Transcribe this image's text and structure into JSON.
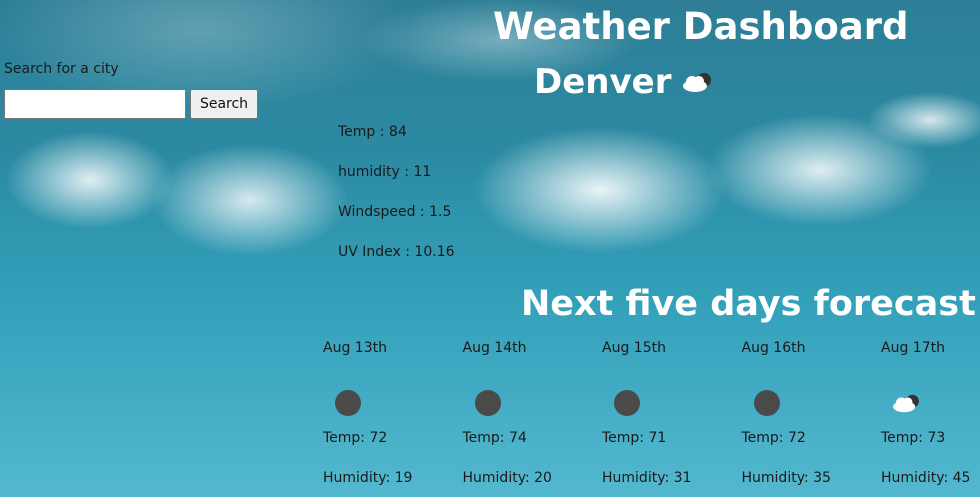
{
  "header": {
    "title": "Weather Dashboard"
  },
  "search": {
    "label": "Search for a city",
    "value": "",
    "placeholder": "",
    "button_label": "Search"
  },
  "current": {
    "city": "Denver",
    "icon": "partly-cloudy-icon",
    "temp": "Temp : 84",
    "humidity": "humidity : 11",
    "windspeed": "Windspeed : 1.5",
    "uv_index": "UV Index : 10.16"
  },
  "forecast": {
    "title": "Next five days forecast",
    "days": [
      {
        "date": "Aug 13th",
        "icon": "dark-dot-icon",
        "temp": "Temp: 72",
        "humidity": "Humidity: 19"
      },
      {
        "date": "Aug 14th",
        "icon": "dark-dot-icon",
        "temp": "Temp: 74",
        "humidity": "Humidity: 20"
      },
      {
        "date": "Aug 15th",
        "icon": "dark-dot-icon",
        "temp": "Temp: 71",
        "humidity": "Humidity: 31"
      },
      {
        "date": "Aug 16th",
        "icon": "dark-dot-icon",
        "temp": "Temp: 72",
        "humidity": "Humidity: 35"
      },
      {
        "date": "Aug 17th",
        "icon": "partly-cloudy-icon",
        "temp": "Temp: 73",
        "humidity": "Humidity: 45"
      }
    ]
  },
  "colors": {
    "heading_text": "#ffffff",
    "body_text": "#1a1a1a",
    "sky": "#2b8aa2"
  }
}
